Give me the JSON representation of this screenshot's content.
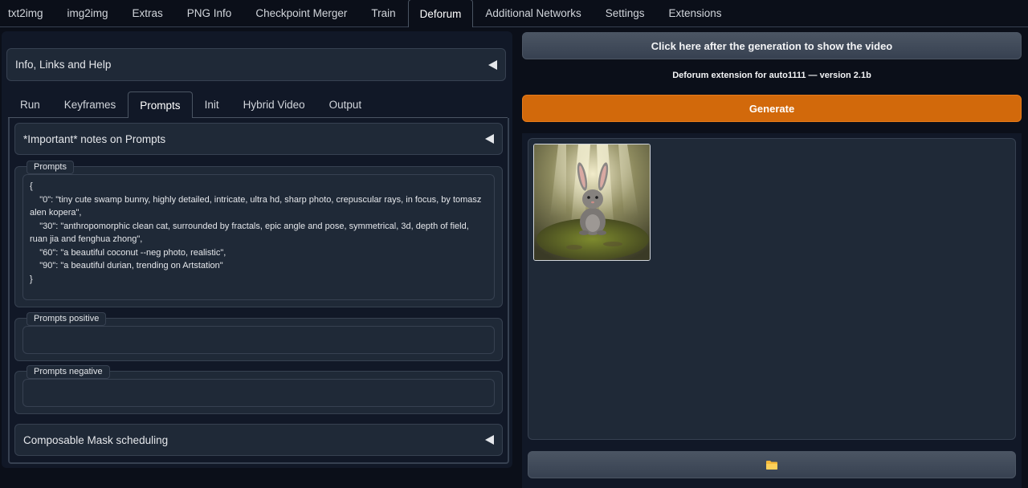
{
  "top_tabs": [
    "txt2img",
    "img2img",
    "Extras",
    "PNG Info",
    "Checkpoint Merger",
    "Train",
    "Deforum",
    "Additional Networks",
    "Settings",
    "Extensions"
  ],
  "active_top_tab": "Deforum",
  "info_accordion": "Info, Links and Help",
  "sub_tabs": [
    "Run",
    "Keyframes",
    "Prompts",
    "Init",
    "Hybrid Video",
    "Output"
  ],
  "active_sub_tab": "Prompts",
  "notes_accordion": "*Important* notes on Prompts",
  "prompts": {
    "label": "Prompts",
    "value": "{\n    \"0\": \"tiny cute swamp bunny, highly detailed, intricate, ultra hd, sharp photo, crepuscular rays, in focus, by tomasz alen kopera\",\n    \"30\": \"anthropomorphic clean cat, surrounded by fractals, epic angle and pose, symmetrical, 3d, depth of field, ruan jia and fenghua zhong\",\n    \"60\": \"a beautiful coconut --neg photo, realistic\",\n    \"90\": \"a beautiful durian, trending on Artstation\"\n}"
  },
  "prompts_positive": {
    "label": "Prompts positive",
    "value": ""
  },
  "prompts_negative": {
    "label": "Prompts negative",
    "value": ""
  },
  "composable_accordion": "Composable Mask scheduling",
  "show_video_button": "Click here after the generation to show the video",
  "version_text": "Deforum extension for auto1111 — version 2.1b",
  "generate_button": "Generate",
  "gallery": {
    "image_subject": "bunny-in-swamp-with-light-rays"
  },
  "folder_icon": "folder-icon",
  "colors": {
    "generate": "#d2690b",
    "background": "#0b0f19",
    "panel": "#111827",
    "block": "#1f2937"
  }
}
